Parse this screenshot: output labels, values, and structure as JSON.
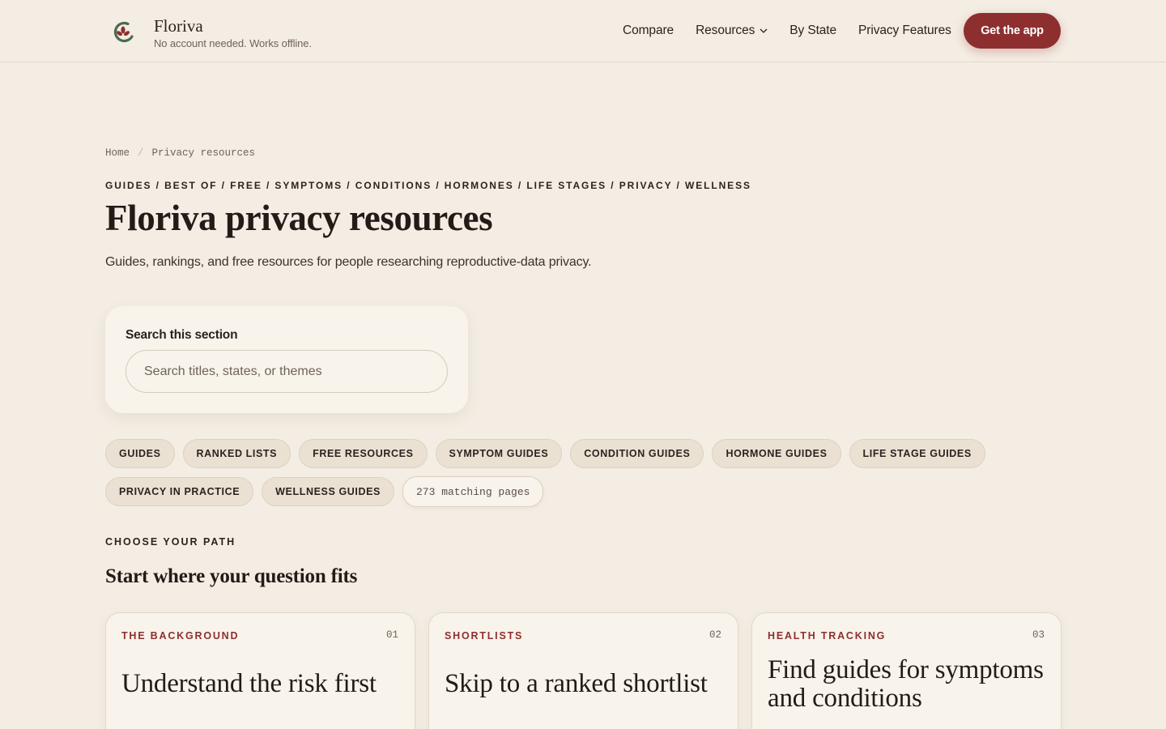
{
  "brand": {
    "name": "Floriva",
    "tagline": "No account needed. Works offline."
  },
  "nav": {
    "items": [
      "Compare",
      "Resources",
      "By State",
      "Privacy Features"
    ],
    "cta": "Get the app"
  },
  "breadcrumb": {
    "home": "Home",
    "separator": "/",
    "current": "Privacy resources"
  },
  "hero": {
    "kicker": "GUIDES / BEST OF / FREE / SYMPTOMS / CONDITIONS / HORMONES / LIFE STAGES / PRIVACY / WELLNESS",
    "title": "Floriva privacy resources",
    "subtitle": "Guides, rankings, and free resources for people researching reproductive-data privacy."
  },
  "search": {
    "label": "Search this section",
    "placeholder": "Search titles, states, or themes"
  },
  "chips": [
    "GUIDES",
    "RANKED LISTS",
    "FREE RESOURCES",
    "SYMPTOM GUIDES",
    "CONDITION GUIDES",
    "HORMONE GUIDES",
    "LIFE STAGE GUIDES",
    "PRIVACY IN PRACTICE",
    "WELLNESS GUIDES"
  ],
  "match_count": "273 matching pages",
  "path_section": {
    "kicker": "CHOOSE YOUR PATH",
    "title": "Start where your question fits"
  },
  "cards": [
    {
      "eyebrow": "THE BACKGROUND",
      "num": "01",
      "title": "Understand the risk first"
    },
    {
      "eyebrow": "SHORTLISTS",
      "num": "02",
      "title": "Skip to a ranked shortlist"
    },
    {
      "eyebrow": "HEALTH TRACKING",
      "num": "03",
      "title": "Find guides for symptoms and conditions"
    }
  ],
  "colors": {
    "background": "#f4ede3",
    "accent": "#8e2f2f",
    "logo_green": "#4a6a4e"
  },
  "icons": {
    "logo": "floriva-leaf-logo-icon",
    "dropdown": "chevron-down-icon"
  }
}
